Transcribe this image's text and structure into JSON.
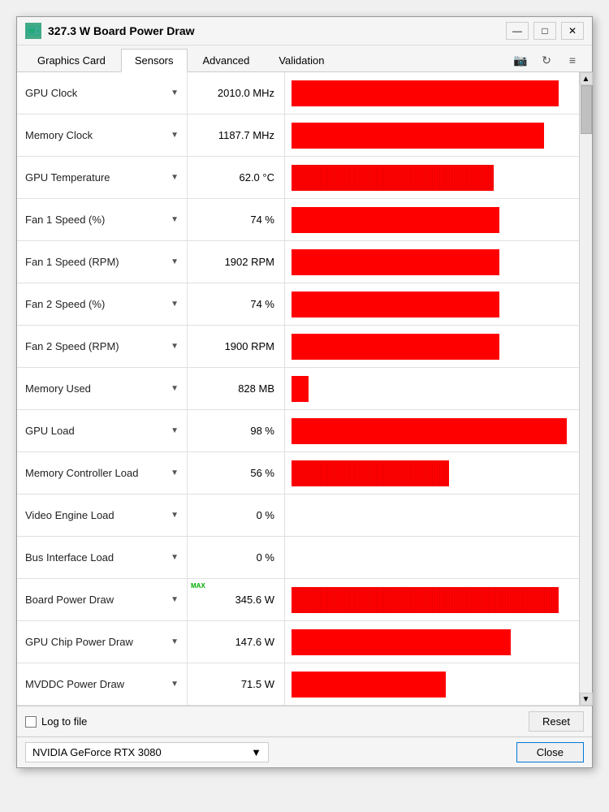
{
  "window": {
    "title": "327.3 W Board Power Draw",
    "icon": "GPU"
  },
  "titlebar": {
    "minimize_label": "—",
    "maximize_label": "□",
    "close_label": "✕"
  },
  "tabs": [
    {
      "id": "graphics-card",
      "label": "Graphics Card",
      "active": false
    },
    {
      "id": "sensors",
      "label": "Sensors",
      "active": true
    },
    {
      "id": "advanced",
      "label": "Advanced",
      "active": false
    },
    {
      "id": "validation",
      "label": "Validation",
      "active": false
    }
  ],
  "tab_icons": {
    "camera": "📷",
    "refresh": "↻",
    "menu": "≡"
  },
  "sensors": [
    {
      "name": "GPU Clock",
      "value": "2010.0 MHz",
      "bar_pct": 95,
      "noisy": false,
      "has_max": false
    },
    {
      "name": "Memory Clock",
      "value": "1187.7 MHz",
      "bar_pct": 90,
      "noisy": false,
      "has_max": false
    },
    {
      "name": "GPU Temperature",
      "value": "62.0 °C",
      "bar_pct": 72,
      "noisy": true,
      "has_max": false
    },
    {
      "name": "Fan 1 Speed (%)",
      "value": "74 %",
      "bar_pct": 74,
      "noisy": false,
      "has_max": false
    },
    {
      "name": "Fan 1 Speed (RPM)",
      "value": "1902 RPM",
      "bar_pct": 74,
      "noisy": false,
      "has_max": false
    },
    {
      "name": "Fan 2 Speed (%)",
      "value": "74 %",
      "bar_pct": 74,
      "noisy": false,
      "has_max": false
    },
    {
      "name": "Fan 2 Speed (RPM)",
      "value": "1900 RPM",
      "bar_pct": 74,
      "noisy": false,
      "has_max": false
    },
    {
      "name": "Memory Used",
      "value": "828 MB",
      "bar_pct": 6,
      "noisy": false,
      "has_max": false
    },
    {
      "name": "GPU Load",
      "value": "98 %",
      "bar_pct": 98,
      "noisy": false,
      "has_max": false
    },
    {
      "name": "Memory Controller Load",
      "value": "56 %",
      "bar_pct": 56,
      "noisy": true,
      "has_max": false
    },
    {
      "name": "Video Engine Load",
      "value": "0 %",
      "bar_pct": 0,
      "noisy": false,
      "has_max": false
    },
    {
      "name": "Bus Interface Load",
      "value": "0 %",
      "bar_pct": 0,
      "noisy": false,
      "has_max": false
    },
    {
      "name": "Board Power Draw",
      "value": "345.6 W",
      "bar_pct": 95,
      "noisy": true,
      "has_max": true
    },
    {
      "name": "GPU Chip Power Draw",
      "value": "147.6 W",
      "bar_pct": 78,
      "noisy": false,
      "has_max": false
    },
    {
      "name": "MVDDC Power Draw",
      "value": "71.5 W",
      "bar_pct": 55,
      "noisy": false,
      "has_max": false
    }
  ],
  "bottom": {
    "log_label": "Log to file",
    "reset_label": "Reset"
  },
  "footer": {
    "gpu_name": "NVIDIA GeForce RTX 3080",
    "close_label": "Close"
  }
}
